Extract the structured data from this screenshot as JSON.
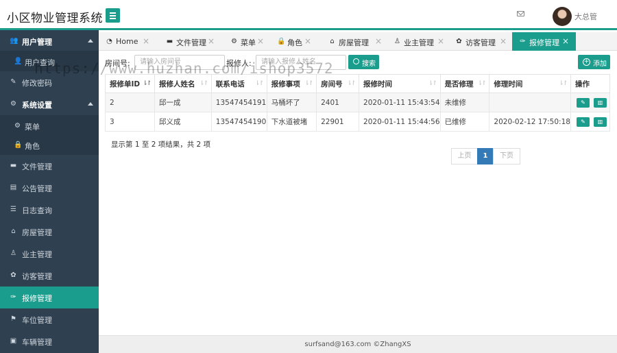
{
  "header": {
    "title": "小区物业管理系统",
    "username": "大总管",
    "icons": {
      "menu": "hamburger-icon",
      "mail": "envelope-icon"
    }
  },
  "sidebar": {
    "items": [
      {
        "label": "用户管理",
        "icon": "users-icon",
        "glyph": "👥",
        "expanded": true
      },
      {
        "label": "用户查询",
        "icon": "user-icon",
        "glyph": "👤",
        "sub": true
      },
      {
        "label": "修改密码",
        "icon": "edit-icon",
        "glyph": "✎"
      },
      {
        "label": "系统设置",
        "icon": "cogs-icon",
        "glyph": "⚙",
        "expanded": true
      },
      {
        "label": "菜单",
        "icon": "gear-icon",
        "glyph": "⚙",
        "sub": true
      },
      {
        "label": "角色",
        "icon": "lock-icon",
        "glyph": "🔒",
        "sub": true
      },
      {
        "label": "文件管理",
        "icon": "folder-icon",
        "glyph": "▬"
      },
      {
        "label": "公告管理",
        "icon": "book-icon",
        "glyph": "▤"
      },
      {
        "label": "日志查询",
        "icon": "list-icon",
        "glyph": "☰"
      },
      {
        "label": "房屋管理",
        "icon": "bank-icon",
        "glyph": "⌂"
      },
      {
        "label": "业主管理",
        "icon": "male-icon",
        "glyph": "♙"
      },
      {
        "label": "访客管理",
        "icon": "paw-icon",
        "glyph": "✿"
      },
      {
        "label": "报修管理",
        "icon": "wrench-icon",
        "glyph": "✑",
        "active": true
      },
      {
        "label": "车位管理",
        "icon": "flag-icon",
        "glyph": "⚑"
      },
      {
        "label": "车辆管理",
        "icon": "car-icon",
        "glyph": "▣"
      }
    ]
  },
  "tabs": [
    {
      "label": "Home",
      "icon": "dashboard-icon",
      "glyph": "◔"
    },
    {
      "label": "文件管理",
      "icon": "folder-open-icon",
      "glyph": "▬"
    },
    {
      "label": "菜单",
      "icon": "gear-icon",
      "glyph": "⚙"
    },
    {
      "label": "角色",
      "icon": "lock-icon",
      "glyph": "🔒"
    },
    {
      "label": "房屋管理",
      "icon": "bank-icon",
      "glyph": "⌂"
    },
    {
      "label": "业主管理",
      "icon": "male-icon",
      "glyph": "♙"
    },
    {
      "label": "访客管理",
      "icon": "paw-icon",
      "glyph": "✿"
    },
    {
      "label": "报修管理",
      "icon": "wrench-icon",
      "glyph": "✑",
      "active": true
    }
  ],
  "search": {
    "room_label": "房间号:",
    "room_placeholder": "请输入房间号",
    "reporter_label": "报修人:",
    "reporter_placeholder": "请输入报修人姓名",
    "search_button": "搜索",
    "add_button": "添加"
  },
  "table": {
    "columns": [
      "报修单ID",
      "报修人姓名",
      "联系电话",
      "报修事项",
      "房间号",
      "报修时间",
      "是否修理",
      "修理时间",
      "操作"
    ],
    "rows": [
      [
        "2",
        "邱一成",
        "13547454191",
        "马桶坏了",
        "2401",
        "2020-01-11 15:43:54",
        "未维修",
        ""
      ],
      [
        "3",
        "邱义成",
        "13547454190",
        "下水道被堵",
        "22901",
        "2020-01-11 15:44:56",
        "已维修",
        "2020-02-12 17:50:18"
      ]
    ]
  },
  "pagination": {
    "info": "显示第 1 至 2 项结果，共 2 项",
    "prev": "上页",
    "current": "1",
    "next": "下页"
  },
  "footer": {
    "text": "surfsand@163.com ©ZhangXS"
  },
  "watermark": "https://www.huzhan.com/ishop3572",
  "colors": {
    "accent": "#1a9d8c",
    "sidebar": "#2f4050",
    "page_active": "#337ab7"
  }
}
